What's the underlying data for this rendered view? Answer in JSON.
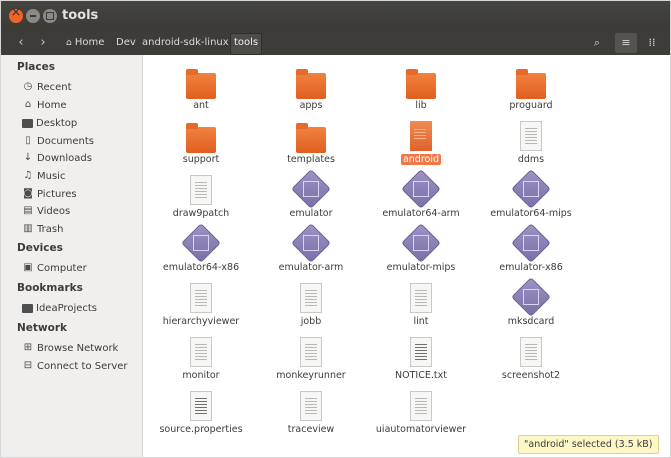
{
  "window": {
    "title": "tools"
  },
  "toolbar": {
    "back_icon": "chevron-left-icon",
    "forward_icon": "chevron-right-icon",
    "breadcrumbs": [
      "Home",
      "Dev",
      "android-sdk-linux",
      "tools"
    ],
    "search_icon": "search-icon",
    "list_icon": "list-view-icon",
    "grid_icon": "grid-view-icon"
  },
  "sidebar": {
    "places_title": "Places",
    "places": [
      {
        "label": "Recent",
        "icon": "clock-icon"
      },
      {
        "label": "Home",
        "icon": "home-icon"
      },
      {
        "label": "Desktop",
        "icon": "desktop-icon"
      },
      {
        "label": "Documents",
        "icon": "documents-icon"
      },
      {
        "label": "Downloads",
        "icon": "downloads-icon"
      },
      {
        "label": "Music",
        "icon": "music-icon"
      },
      {
        "label": "Pictures",
        "icon": "pictures-icon"
      },
      {
        "label": "Videos",
        "icon": "videos-icon"
      },
      {
        "label": "Trash",
        "icon": "trash-icon"
      }
    ],
    "devices_title": "Devices",
    "devices": [
      {
        "label": "Computer",
        "icon": "computer-icon"
      }
    ],
    "bookmarks_title": "Bookmarks",
    "bookmarks": [
      {
        "label": "IdeaProjects",
        "icon": "folder-icon"
      }
    ],
    "network_title": "Network",
    "network": [
      {
        "label": "Browse Network",
        "icon": "network-icon"
      },
      {
        "label": "Connect to Server",
        "icon": "server-icon"
      }
    ]
  },
  "files": [
    {
      "name": "ant",
      "type": "folder"
    },
    {
      "name": "apps",
      "type": "folder"
    },
    {
      "name": "lib",
      "type": "folder"
    },
    {
      "name": "proguard",
      "type": "folder"
    },
    {
      "name": "support",
      "type": "folder"
    },
    {
      "name": "templates",
      "type": "folder"
    },
    {
      "name": "android",
      "type": "script",
      "selected": true
    },
    {
      "name": "ddms",
      "type": "script"
    },
    {
      "name": "draw9patch",
      "type": "script"
    },
    {
      "name": "emulator",
      "type": "executable"
    },
    {
      "name": "emulator64-arm",
      "type": "executable"
    },
    {
      "name": "emulator64-mips",
      "type": "executable"
    },
    {
      "name": "emulator64-x86",
      "type": "executable"
    },
    {
      "name": "emulator-arm",
      "type": "executable"
    },
    {
      "name": "emulator-mips",
      "type": "executable"
    },
    {
      "name": "emulator-x86",
      "type": "executable"
    },
    {
      "name": "hierarchyviewer",
      "type": "script"
    },
    {
      "name": "jobb",
      "type": "script"
    },
    {
      "name": "lint",
      "type": "script"
    },
    {
      "name": "mksdcard",
      "type": "executable"
    },
    {
      "name": "monitor",
      "type": "script"
    },
    {
      "name": "monkeyrunner",
      "type": "script"
    },
    {
      "name": "NOTICE.txt",
      "type": "text"
    },
    {
      "name": "screenshot2",
      "type": "script"
    },
    {
      "name": "source.properties",
      "type": "text"
    },
    {
      "name": "traceview",
      "type": "script"
    },
    {
      "name": "uiautomatorviewer",
      "type": "script"
    }
  ],
  "status": {
    "text": "\"android\" selected  (3.5 kB)"
  },
  "colors": {
    "accent": "#f07746",
    "titlebar": "#3b3a36",
    "sidebar": "#f0efed",
    "status_bg": "#fbf7c6"
  }
}
